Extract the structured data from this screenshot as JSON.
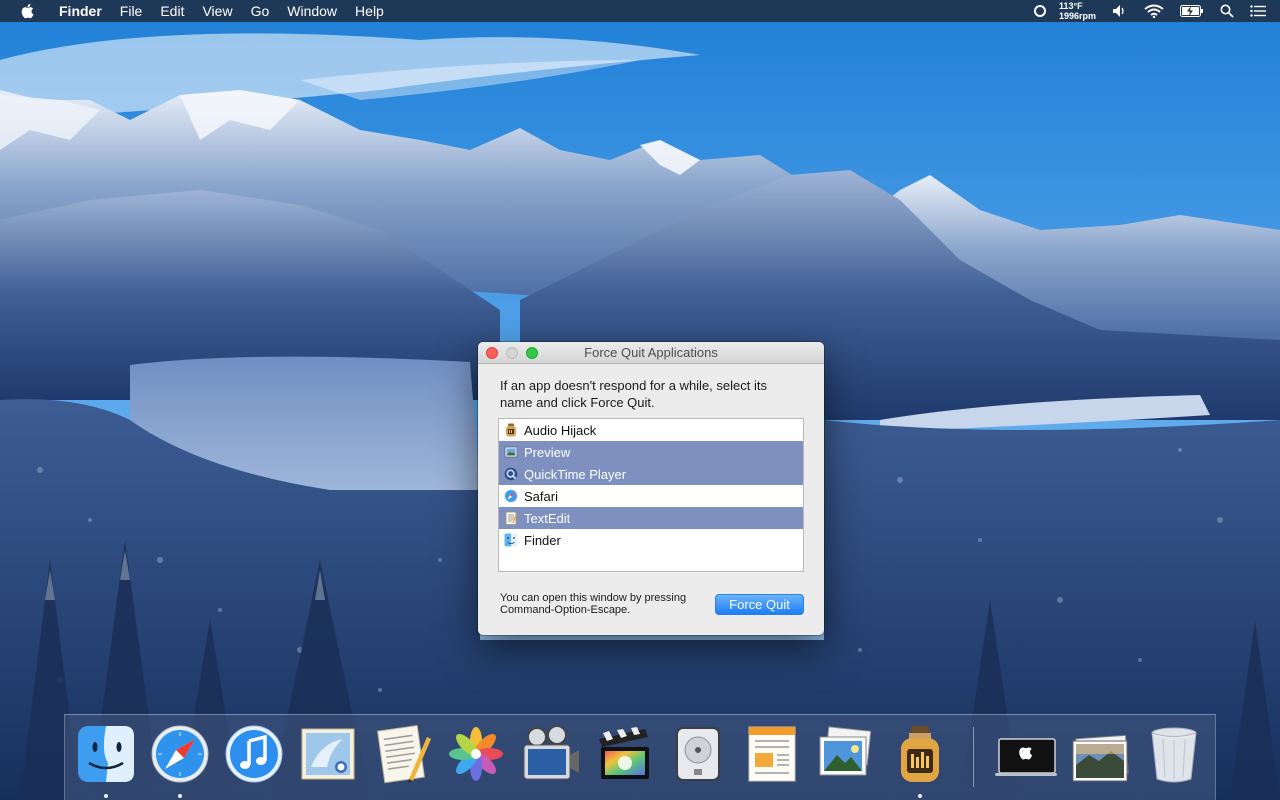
{
  "menubar": {
    "app_name": "Finder",
    "items": [
      "File",
      "Edit",
      "View",
      "Go",
      "Window",
      "Help"
    ],
    "temperature": "113°F",
    "fan_speed": "1996rpm"
  },
  "force_quit": {
    "title": "Force Quit Applications",
    "description": "If an app doesn't respond for a while, select its name and click Force Quit.",
    "apps": [
      {
        "name": "Audio Hijack",
        "selected": false,
        "icon": "audio-hijack-icon"
      },
      {
        "name": "Preview",
        "selected": true,
        "icon": "preview-icon"
      },
      {
        "name": "QuickTime Player",
        "selected": true,
        "icon": "quicktime-icon"
      },
      {
        "name": "Safari",
        "selected": false,
        "icon": "safari-icon"
      },
      {
        "name": "TextEdit",
        "selected": true,
        "icon": "textedit-icon"
      },
      {
        "name": "Finder",
        "selected": false,
        "icon": "finder-icon"
      }
    ],
    "footnote": "You can open this window by pressing Command-Option-Escape.",
    "button_label": "Force Quit"
  },
  "dock": {
    "apps": [
      {
        "name": "Finder",
        "icon": "finder-icon",
        "running": true
      },
      {
        "name": "Safari",
        "icon": "safari-icon",
        "running": true
      },
      {
        "name": "iTunes",
        "icon": "itunes-icon",
        "running": false
      },
      {
        "name": "Mail",
        "icon": "mail-icon",
        "running": false
      },
      {
        "name": "TextEdit",
        "icon": "textedit-icon",
        "running": false
      },
      {
        "name": "Photos",
        "icon": "photos-icon",
        "running": false
      },
      {
        "name": "Photo Booth",
        "icon": "photo-booth-icon",
        "running": false
      },
      {
        "name": "Final Cut Pro",
        "icon": "final-cut-icon",
        "running": false
      },
      {
        "name": "Disk Utility",
        "icon": "disk-utility-icon",
        "running": false
      },
      {
        "name": "Pages",
        "icon": "pages-icon",
        "running": false
      },
      {
        "name": "Preview",
        "icon": "preview-icon",
        "running": false
      },
      {
        "name": "Audio Hijack",
        "icon": "audio-hijack-icon",
        "running": true
      }
    ],
    "folders": [
      {
        "name": "Applications",
        "icon": "macbook-icon"
      },
      {
        "name": "Pictures",
        "icon": "landscape-stack-icon"
      },
      {
        "name": "Trash",
        "icon": "trash-icon"
      }
    ]
  },
  "colors": {
    "selection": "#7d90bf",
    "button_blue": "#1b7df5",
    "menubar": "#1e283c"
  }
}
